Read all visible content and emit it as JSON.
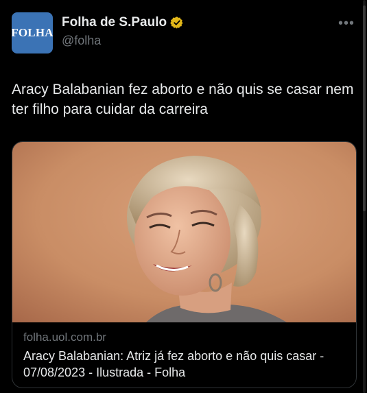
{
  "author": {
    "avatar_text": "FOLHA",
    "display_name": "Folha de S.Paulo",
    "handle": "@folha",
    "verified": true,
    "verified_badge_color": "#e2b719",
    "avatar_color": "#3b73b5"
  },
  "more_icon": "more-horizontal-icon",
  "more_glyph": "•••",
  "post": {
    "text": "Aracy Balabanian fez aborto e não quis se casar nem ter filho para cuidar da carreira"
  },
  "link_card": {
    "domain": "folha.uol.com.br",
    "title": "Aracy Balabanian: Atriz já fez aborto e não quis casar - 07/08/2023 - Ilustrada - Folha"
  },
  "colors": {
    "background": "#000000",
    "text_primary": "#e7e9ea",
    "text_secondary": "#71767b",
    "border": "#2f3336",
    "photo_background": "#c98d65"
  }
}
